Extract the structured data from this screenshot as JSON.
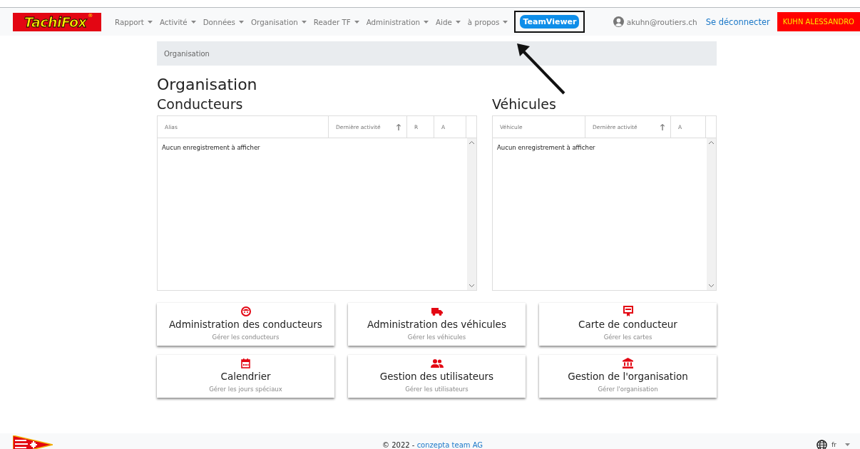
{
  "logo": {
    "text": "TachiFox",
    "mark": "®"
  },
  "nav": [
    {
      "label": "Rapport",
      "dropdown": true
    },
    {
      "label": "Activité",
      "dropdown": true
    },
    {
      "label": "Données",
      "dropdown": true
    },
    {
      "label": "Organisation",
      "dropdown": true
    },
    {
      "label": "Reader TF",
      "dropdown": true
    },
    {
      "label": "Administration",
      "dropdown": true
    },
    {
      "label": "Aide",
      "dropdown": true
    },
    {
      "label": "à propos",
      "dropdown": true
    }
  ],
  "teamviewer": {
    "label": "TeamViewer",
    "highlighted": true
  },
  "user": {
    "email": "akuhn@routiers.ch",
    "logout": "Se déconnecter",
    "name": "KUHN ALESSANDRO"
  },
  "breadcrumb": "Organisation",
  "title": "Organisation",
  "tables": [
    {
      "title": "Conducteurs",
      "columns": [
        {
          "label": "Alias",
          "sorted": false
        },
        {
          "label": "Dernière activité",
          "sorted": true
        },
        {
          "label": "R",
          "sorted": false
        },
        {
          "label": "A",
          "sorted": false
        }
      ],
      "empty": "Aucun enregistrement à afficher"
    },
    {
      "title": "Véhicules",
      "columns": [
        {
          "label": "Véhicule",
          "sorted": false
        },
        {
          "label": "Dernière activité",
          "sorted": true
        },
        {
          "label": "A",
          "sorted": false
        }
      ],
      "empty": "Aucun enregistrement à afficher"
    }
  ],
  "cards": [
    {
      "kind": "driver",
      "title": "Administration des conducteurs",
      "subtitle": "Gérer les conducteurs"
    },
    {
      "kind": "truck",
      "title": "Administration des véhicules",
      "subtitle": "Gérer les véhicules"
    },
    {
      "kind": "card",
      "title": "Carte de conducteur",
      "subtitle": "Gérer les cartes"
    },
    {
      "kind": "calendar",
      "title": "Calendrier",
      "subtitle": "Gérer les jours spéciaux"
    },
    {
      "kind": "users",
      "title": "Gestion des utilisateurs",
      "subtitle": "Gérer les utilisateurs"
    },
    {
      "kind": "bank",
      "title": "Gestion de l'organisation",
      "subtitle": "Gérer l'organisation"
    }
  ],
  "footer": {
    "copyright": "© 2022 - ",
    "company": "conzepta team AG",
    "language": "fr"
  }
}
